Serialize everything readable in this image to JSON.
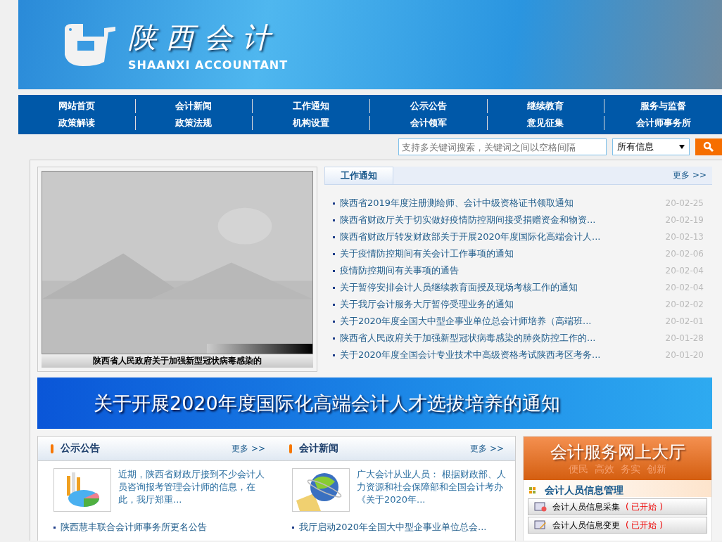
{
  "header": {
    "logo_title": "陕西会计",
    "logo_subtitle": "SHAANXI ACCOUNTANT"
  },
  "nav": [
    {
      "label": "网站首页"
    },
    {
      "label": "会计新闻"
    },
    {
      "label": "工作通知"
    },
    {
      "label": "公示公告"
    },
    {
      "label": "继续教育"
    },
    {
      "label": "服务与监督"
    },
    {
      "label": "政策解读"
    },
    {
      "label": "政策法规"
    },
    {
      "label": "机构设置"
    },
    {
      "label": "会计领军"
    },
    {
      "label": "意见征集"
    },
    {
      "label": "会计师事务所"
    }
  ],
  "search": {
    "placeholder": "支持多关键词搜索，关键词之间以空格间隔",
    "scope": "所有信息"
  },
  "slideshow": {
    "caption": "陕西省人民政府关于加强新型冠状病毒感染的"
  },
  "work_notices": {
    "title": "工作通知",
    "more": "更多 >>",
    "items": [
      {
        "title": "陕西省2019年度注册测绘师、会计中级资格证书领取通知",
        "date": "20-02-25"
      },
      {
        "title": "陕西省财政厅关于切实做好疫情防控期间接受捐赠资金和物资...",
        "date": "20-02-19"
      },
      {
        "title": "陕西省财政厅转发财政部关于开展2020年度国际化高端会计人...",
        "date": "20-02-13"
      },
      {
        "title": "关于疫情防控期间有关会计工作事项的通知",
        "date": "20-02-06"
      },
      {
        "title": "疫情防控期间有关事项的通告",
        "date": "20-02-04"
      },
      {
        "title": "关于暂停安排会计人员继续教育面授及现场考核工作的通知",
        "date": "20-02-04"
      },
      {
        "title": "关于我厅会计服务大厅暂停受理业务的通知",
        "date": "20-02-02"
      },
      {
        "title": "关于2020年度全国大中型企事业单位总会计师培养（高端班...",
        "date": "20-02-01"
      },
      {
        "title": "陕西省人民政府关于加强新型冠状病毒感染的肺炎防控工作的...",
        "date": "20-01-28"
      },
      {
        "title": "关于2020年度全国会计专业技术中高级资格考试陕西考区考务...",
        "date": "20-01-20"
      }
    ]
  },
  "banner": {
    "text": "关于开展2020年度国际化高端会计人才选拔培养的通知"
  },
  "sections": [
    {
      "kind": "chart",
      "title": "公示公告",
      "more": "更多 >>",
      "summary": "近期，陕西省财政厅接到不少会计人员咨询报考管理会计师的信息，在此，我厅郑重...",
      "items": [
        "陕西慧丰联合会计师事务所更名公告"
      ]
    },
    {
      "kind": "globe",
      "title": "会计新闻",
      "more": "更多 >>",
      "summary": "广大会计从业人员： 根据财政部、人力资源和社会保障部和全国会计考办《关于2020年...",
      "items": [
        "我厅启动2020年全国大中型企事业单位总会..."
      ]
    }
  ],
  "service_hall": {
    "title": "会计服务网上大厅",
    "slogan": "便民  高效  务实  创新",
    "group": "会计人员信息管理",
    "links": [
      {
        "kind": "collect",
        "label": "会计人员信息采集",
        "status": "( 已开始 )"
      },
      {
        "kind": "edit",
        "label": "会计人员信息变更",
        "status": "( 已开始 )"
      }
    ]
  }
}
